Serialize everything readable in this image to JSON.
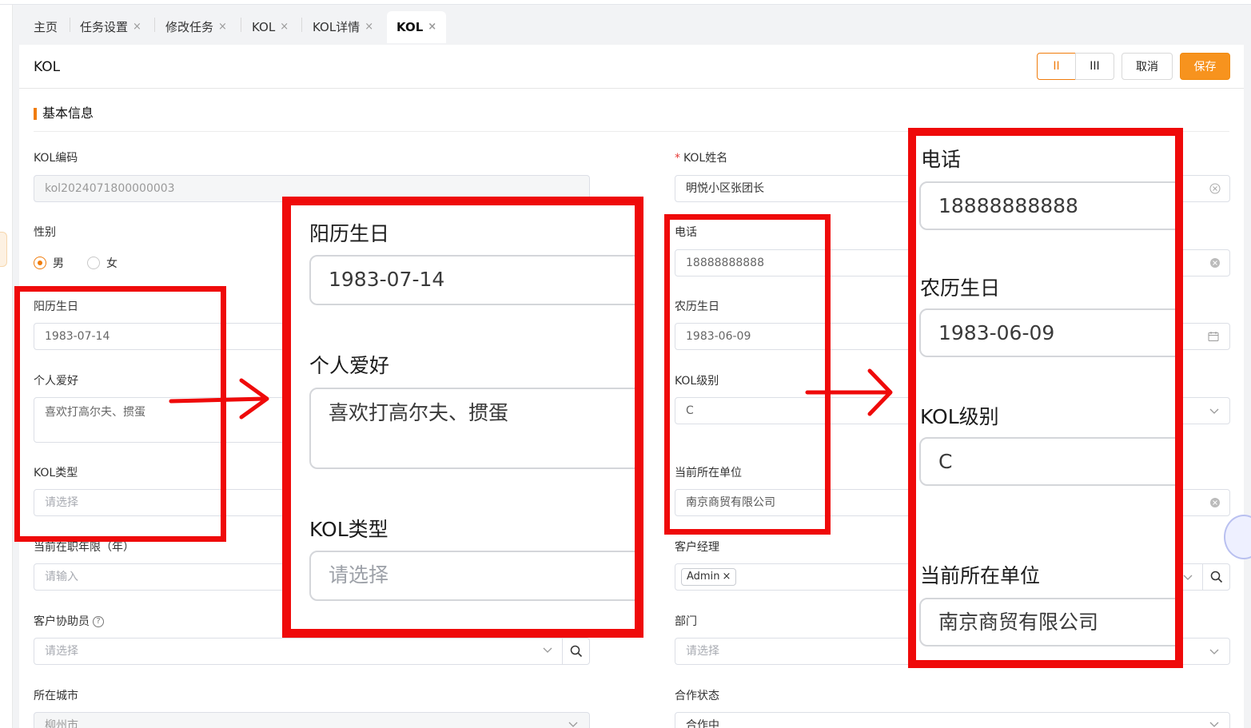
{
  "tabs": [
    {
      "label": "主页",
      "closable": false
    },
    {
      "label": "任务设置",
      "closable": true
    },
    {
      "label": "修改任务",
      "closable": true
    },
    {
      "label": "KOL",
      "closable": true
    },
    {
      "label": "KOL详情",
      "closable": true
    },
    {
      "label": "KOL",
      "closable": true,
      "active": true
    }
  ],
  "close_glyph": "×",
  "header": {
    "title": "KOL",
    "layout2_label": "II",
    "layout3_label": "III",
    "cancel_label": "取消",
    "save_label": "保存"
  },
  "section": {
    "title": "基本信息"
  },
  "form": {
    "kol_code": {
      "label": "KOL编码",
      "value": "kol2024071800000003"
    },
    "kol_name": {
      "label": "KOL姓名",
      "required_mark": "*",
      "value": "明悦小区张团长"
    },
    "gender": {
      "label": "性别",
      "options": [
        "男",
        "女"
      ],
      "selected": "男"
    },
    "phone": {
      "label": "电话",
      "value": "18888888888"
    },
    "solar_birthday": {
      "label": "阳历生日",
      "value": "1983-07-14"
    },
    "lunar_birthday": {
      "label": "农历生日",
      "value": "1983-06-09"
    },
    "hobby": {
      "label": "个人爱好",
      "value": "喜欢打高尔夫、掼蛋"
    },
    "kol_level": {
      "label": "KOL级别",
      "value": "C"
    },
    "kol_type": {
      "label": "KOL类型",
      "placeholder": "请选择"
    },
    "current_company": {
      "label": "当前所在单位",
      "value": "南京商贸有限公司"
    },
    "years": {
      "label": "当前在职年限（年）",
      "placeholder": "请输入"
    },
    "account_manager": {
      "label": "客户经理",
      "tag": "Admin"
    },
    "assistant": {
      "label": "客户协助员",
      "placeholder": "请选择"
    },
    "department": {
      "label": "部门",
      "placeholder": "请选择"
    },
    "city": {
      "label": "所在城市",
      "value": "柳州市"
    },
    "coop_status": {
      "label": "合作状态",
      "value": "合作中"
    }
  },
  "colors": {
    "accent": "#f07c0c",
    "annotation": "#ef0a0a"
  },
  "icons": {
    "clear": "clear-circle-icon",
    "calendar": "calendar-icon",
    "dropdown": "chevron-down-icon",
    "search": "search-icon",
    "help": "question-circle-icon"
  }
}
